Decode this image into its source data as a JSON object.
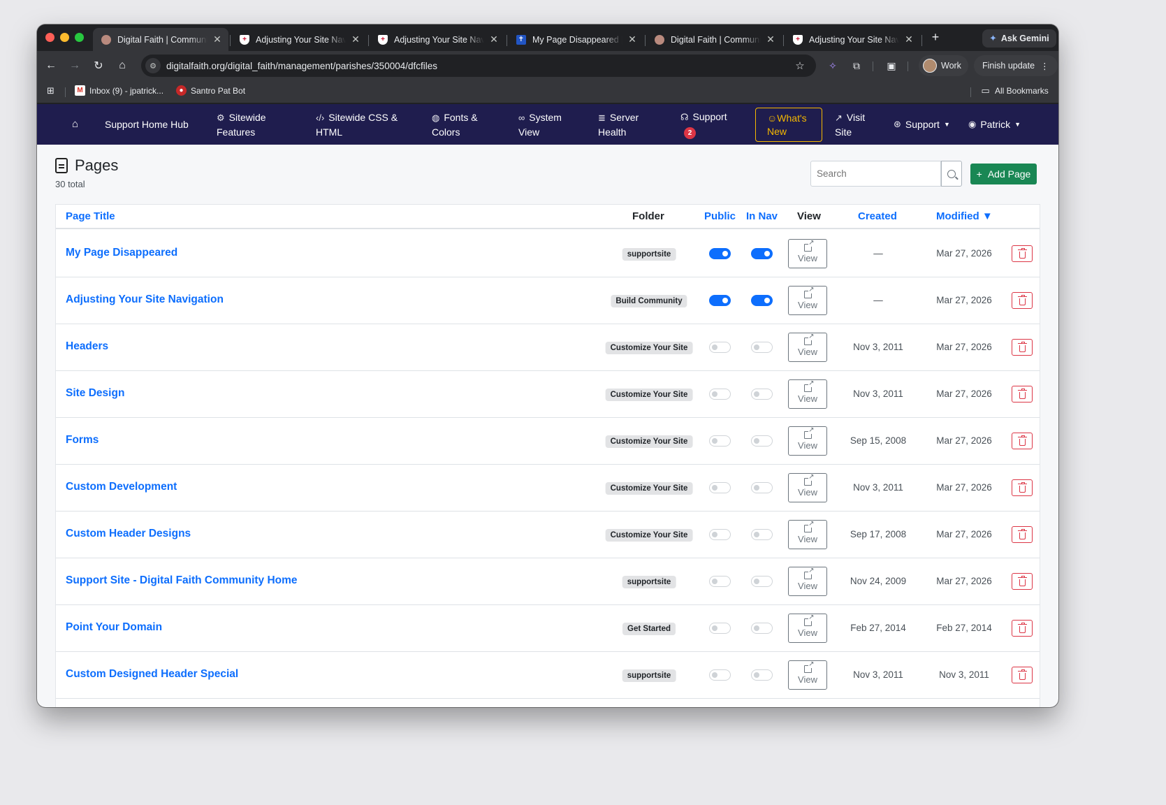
{
  "browser": {
    "tabs": [
      {
        "title": "Digital Faith | Community",
        "favicon": "globe-icon",
        "active": true
      },
      {
        "title": "Adjusting Your Site Navig",
        "favicon": "shield-icon",
        "active": false
      },
      {
        "title": "Adjusting Your Site Navig",
        "favicon": "shield-icon",
        "active": false
      },
      {
        "title": "My Page Disappeared | D",
        "favicon": "cross-icon",
        "active": false
      },
      {
        "title": "Digital Faith | Community",
        "favicon": "globe-icon",
        "active": false
      },
      {
        "title": "Adjusting Your Site Navig",
        "favicon": "shield-icon",
        "active": false
      }
    ],
    "ask_gemini": "Ask Gemini",
    "url": "digitalfaith.org/digital_faith/management/parishes/350004/dfcfiles",
    "profile_label": "Work",
    "finish_update": "Finish update",
    "bookmarks": [
      {
        "label": "Inbox (9) - jpatrick...",
        "icon": "mail-icon"
      },
      {
        "label": "Santro Pat Bot",
        "icon": "bot-icon"
      }
    ],
    "all_bookmarks": "All Bookmarks"
  },
  "nav": {
    "brand": "Support Home Hub",
    "items": [
      {
        "line1": "Sitewide",
        "line2": "Features",
        "icon": "gear-icon"
      },
      {
        "line1": "Sitewide CSS &",
        "line2": "HTML",
        "icon": "code-icon"
      },
      {
        "line1": "Fonts &",
        "line2": "Colors",
        "icon": "palette-icon"
      },
      {
        "line1": "System",
        "line2": "View",
        "icon": "binoculars-icon"
      },
      {
        "line1": "Server",
        "line2": "Health",
        "icon": "database-icon"
      }
    ],
    "support": {
      "label": "Support",
      "badge": "2"
    },
    "whats_new": {
      "line1": "What's",
      "line2": "New"
    },
    "visit_site": {
      "line1": "Visit",
      "line2": "Site"
    },
    "support_menu": "Support",
    "user_menu": "Patrick"
  },
  "page": {
    "title": "Pages",
    "count": "30 total",
    "search_placeholder": "Search",
    "add_button": "Add Page"
  },
  "table": {
    "headers": {
      "title": "Page Title",
      "folder": "Folder",
      "public": "Public",
      "in_nav": "In Nav",
      "view": "View",
      "created": "Created",
      "modified": "Modified",
      "sort_indicator": "▼"
    },
    "view_label": "View",
    "rows": [
      {
        "title": "My Page Disappeared",
        "folder": "supportsite",
        "public": true,
        "in_nav": true,
        "created": "—",
        "modified": "Mar 27, 2026"
      },
      {
        "title": "Adjusting Your Site Navigation",
        "folder": "Build Community",
        "public": true,
        "in_nav": true,
        "created": "—",
        "modified": "Mar 27, 2026"
      },
      {
        "title": "Headers",
        "folder": "Customize Your Site",
        "public": false,
        "in_nav": false,
        "created": "Nov 3, 2011",
        "modified": "Mar 27, 2026"
      },
      {
        "title": "Site Design",
        "folder": "Customize Your Site",
        "public": false,
        "in_nav": false,
        "created": "Nov 3, 2011",
        "modified": "Mar 27, 2026"
      },
      {
        "title": "Forms",
        "folder": "Customize Your Site",
        "public": false,
        "in_nav": false,
        "created": "Sep 15, 2008",
        "modified": "Mar 27, 2026"
      },
      {
        "title": "Custom Development",
        "folder": "Customize Your Site",
        "public": false,
        "in_nav": false,
        "created": "Nov 3, 2011",
        "modified": "Mar 27, 2026"
      },
      {
        "title": "Custom Header Designs",
        "folder": "Customize Your Site",
        "public": false,
        "in_nav": false,
        "created": "Sep 17, 2008",
        "modified": "Mar 27, 2026"
      },
      {
        "title": "Support Site - Digital Faith Community Home",
        "folder": "supportsite",
        "public": false,
        "in_nav": false,
        "created": "Nov 24, 2009",
        "modified": "Mar 27, 2026"
      },
      {
        "title": "Point Your Domain",
        "folder": "Get Started",
        "public": false,
        "in_nav": false,
        "created": "Feb 27, 2014",
        "modified": "Feb 27, 2014"
      },
      {
        "title": "Custom Designed Header Special",
        "folder": "supportsite",
        "public": false,
        "in_nav": false,
        "created": "Nov 3, 2011",
        "modified": "Nov 3, 2011"
      }
    ]
  },
  "colors": {
    "nav_bg": "#1f1d4e",
    "link": "#0d6efd",
    "add_button": "#198754",
    "danger": "#dc3545",
    "highlight": "#f5b800"
  }
}
